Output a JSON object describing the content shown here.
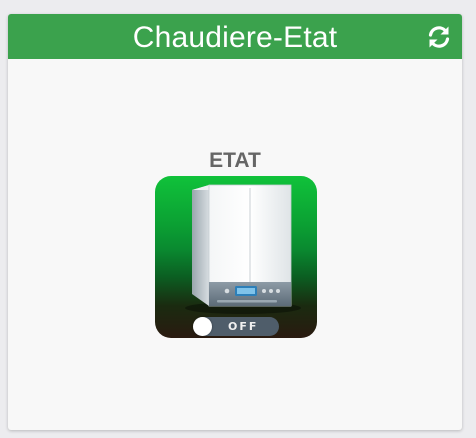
{
  "widget": {
    "title": "Chaudiere-Etat",
    "header_color": "#3ba24d",
    "refresh_icon": "refresh-icon"
  },
  "command": {
    "label": "ETAT",
    "image": "boiler-icon",
    "state_text": "OFF",
    "state_on": false
  }
}
